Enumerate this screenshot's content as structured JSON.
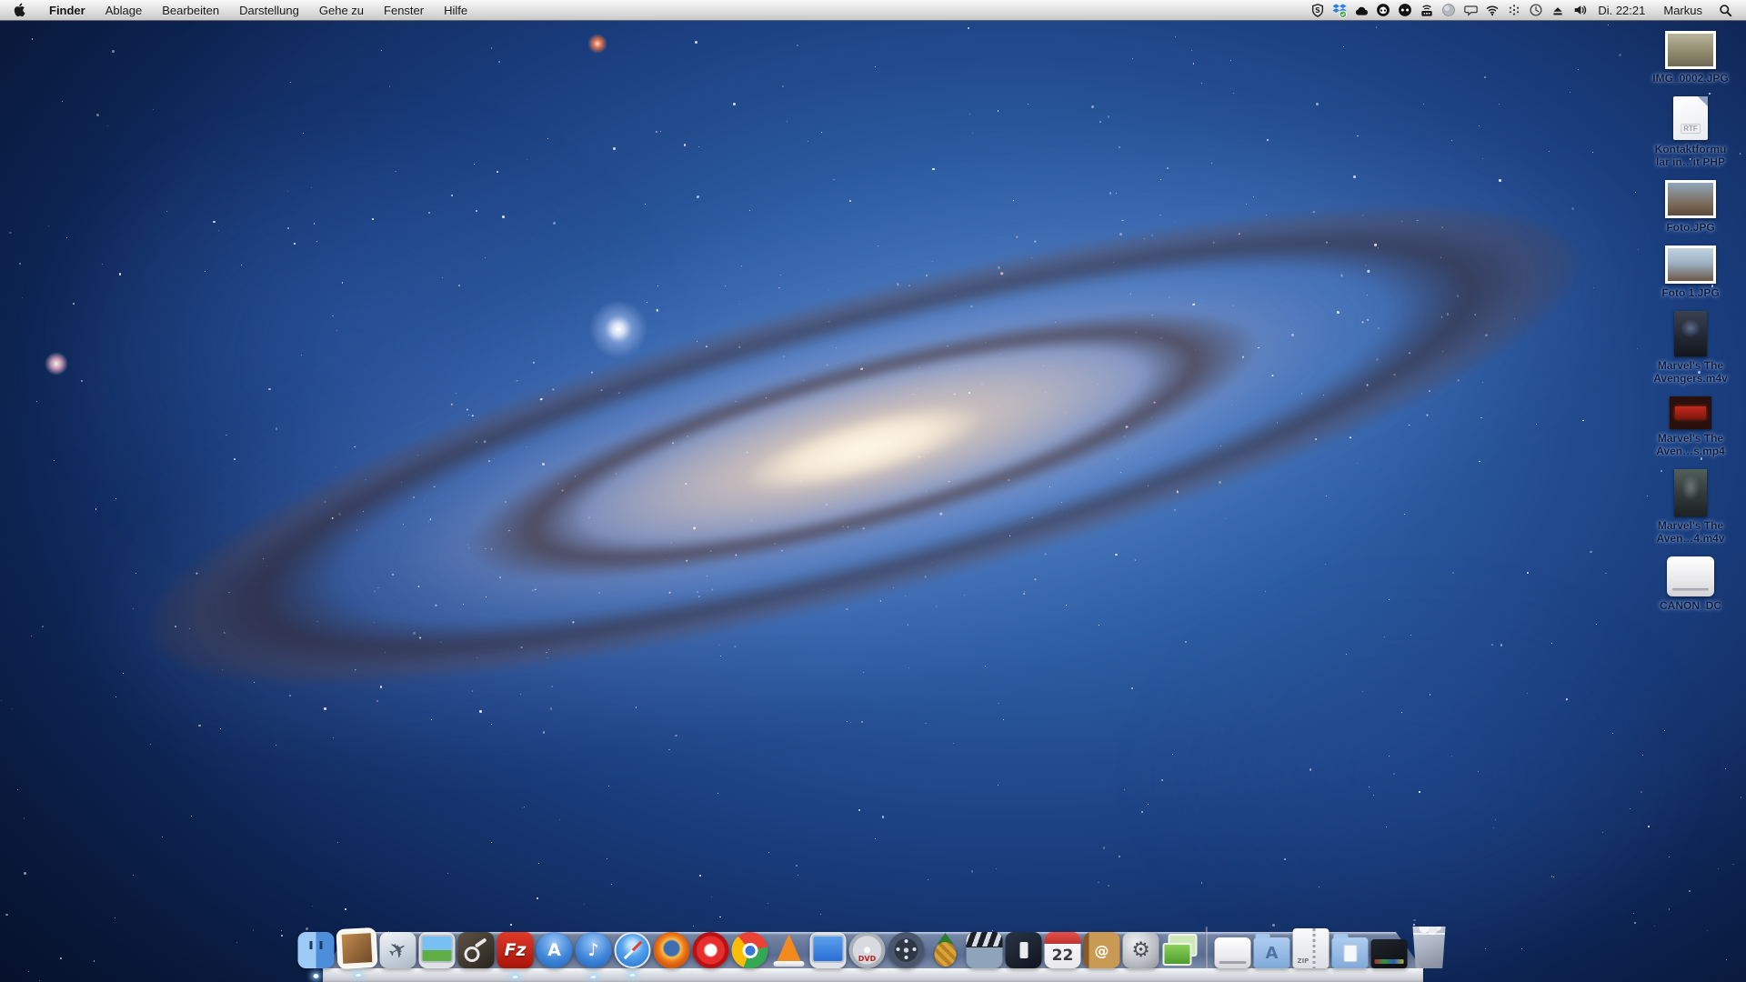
{
  "menubar": {
    "menus": [
      {
        "label": "Finder",
        "bold": true
      },
      {
        "label": "Ablage"
      },
      {
        "label": "Bearbeiten"
      },
      {
        "label": "Darstellung"
      },
      {
        "label": "Gehe zu"
      },
      {
        "label": "Fenster"
      },
      {
        "label": "Hilfe"
      }
    ],
    "status_icons": [
      {
        "name": "shield-icon"
      },
      {
        "name": "dropbox-icon"
      },
      {
        "name": "cloud-icon"
      },
      {
        "name": "round-face-icon"
      },
      {
        "name": "round-dots-icon"
      },
      {
        "name": "wireless-device-icon"
      },
      {
        "name": "globe-icon"
      },
      {
        "name": "speech-bubble-icon"
      },
      {
        "name": "wifi-icon"
      },
      {
        "name": "dots-asterisk-icon"
      },
      {
        "name": "time-machine-icon"
      },
      {
        "name": "eject-icon"
      },
      {
        "name": "volume-icon"
      }
    ],
    "clock": "Di. 22:21",
    "user": "Markus"
  },
  "desktop_icons": [
    {
      "kind": "photo1",
      "label": "IMG_0002.JPG"
    },
    {
      "kind": "rtf",
      "label": "Kontaktformu\nlar in…it PHP",
      "badge": "RTF"
    },
    {
      "kind": "photo2",
      "label": "Foto.JPG"
    },
    {
      "kind": "photo3",
      "label": "Foto 1.JPG"
    },
    {
      "kind": "poster1",
      "label": "Marvel's The\nAvengers.m4v"
    },
    {
      "kind": "clip",
      "label": "Marvel's The\nAven…s.mp4"
    },
    {
      "kind": "poster2",
      "label": "Marvel's The\nAven…4.m4v"
    },
    {
      "kind": "drive",
      "label": "CANON_DC"
    }
  ],
  "dock": {
    "items": [
      {
        "name": "finder",
        "running": true
      },
      {
        "name": "mail",
        "running": true
      },
      {
        "name": "flight-sim",
        "glyph": "✈"
      },
      {
        "name": "remote-desktop"
      },
      {
        "name": "steam"
      },
      {
        "name": "filezilla",
        "glyph": "Fz",
        "running": true
      },
      {
        "name": "app-store",
        "glyph": "A"
      },
      {
        "name": "itunes",
        "glyph": "♪",
        "running": true
      },
      {
        "name": "safari",
        "running": true
      },
      {
        "name": "firefox"
      },
      {
        "name": "opera"
      },
      {
        "name": "chrome"
      },
      {
        "name": "vlc"
      },
      {
        "name": "display"
      },
      {
        "name": "dvd",
        "glyph": "DVD"
      },
      {
        "name": "film-reel"
      },
      {
        "name": "handbrake"
      },
      {
        "name": "clapperboard"
      },
      {
        "name": "media-box"
      },
      {
        "name": "calendar",
        "glyph": "22"
      },
      {
        "name": "address-book",
        "glyph": "@"
      },
      {
        "name": "system-preferences",
        "glyph": "⚙"
      },
      {
        "name": "screen-sharing"
      },
      {
        "name": "separator",
        "kind": "separator"
      },
      {
        "name": "drive"
      },
      {
        "name": "applications-folder",
        "glyph": "A"
      },
      {
        "name": "zip-archive",
        "glyph": "ZIP"
      },
      {
        "name": "documents-folder"
      },
      {
        "name": "media-stack"
      },
      {
        "name": "trash"
      }
    ]
  }
}
